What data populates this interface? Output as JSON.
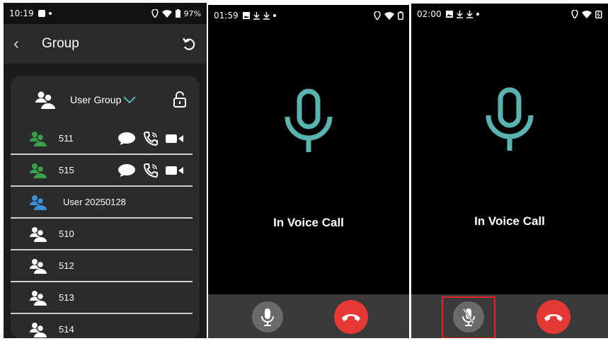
{
  "panel1": {
    "status": {
      "time": "10:19",
      "battery": "97%"
    },
    "title": "Group",
    "group_name": "User Group",
    "members": [
      {
        "name": "511",
        "online": true,
        "actions": true
      },
      {
        "name": "515",
        "online": true,
        "actions": true
      },
      {
        "name": "User  20250128",
        "self": true,
        "actions": false
      },
      {
        "name": "510",
        "online": false,
        "actions": false
      },
      {
        "name": "512",
        "online": false,
        "actions": false
      },
      {
        "name": "513",
        "online": false,
        "actions": false
      },
      {
        "name": "514",
        "online": false,
        "actions": false
      }
    ],
    "colors": {
      "online": "#3aa14a",
      "self": "#3a8fd6",
      "offline": "#ffffff",
      "accent": "#5bb3b0"
    }
  },
  "panel2": {
    "status": {
      "time": "01:59"
    },
    "call_label": "In Voice Call"
  },
  "panel3": {
    "status": {
      "time": "02:00"
    },
    "call_label": "In Voice Call",
    "mic_muted": true
  },
  "icons": {
    "back": "chevron-left-icon",
    "refresh": "refresh-icon",
    "group": "people-icon",
    "lock": "unlock-icon",
    "message": "chat-bubble-icon",
    "call": "phone-call-icon",
    "video": "video-icon",
    "mic": "microphone-icon",
    "hangup": "hang-up-icon"
  }
}
